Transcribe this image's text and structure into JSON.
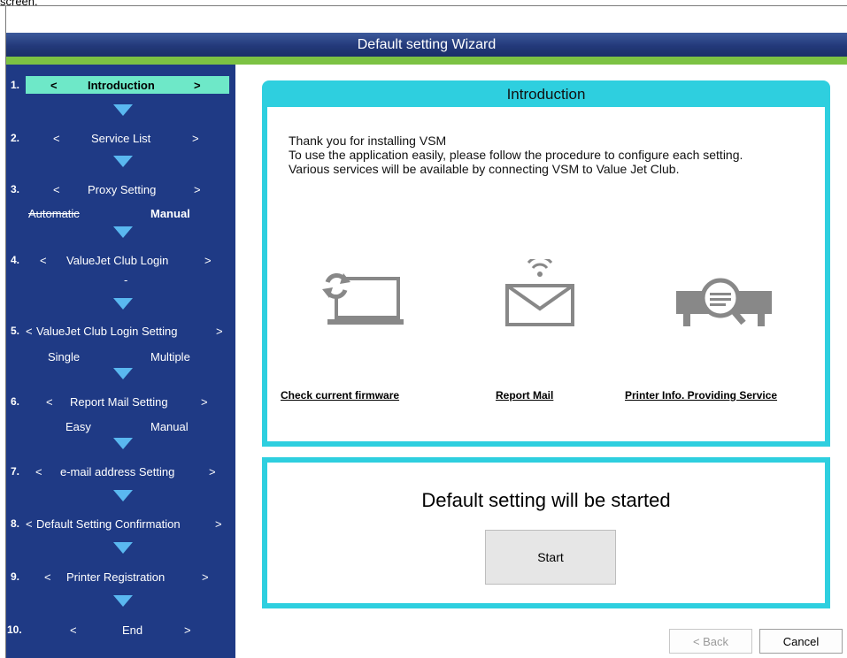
{
  "screen_word": "screen.",
  "window": {
    "title": "Default setting Wizard"
  },
  "steps": [
    {
      "num": "1.",
      "lt": "<",
      "label": "Introduction",
      "gt": ">"
    },
    {
      "num": "2.",
      "lt": "<",
      "label": "Service List",
      "gt": ">"
    },
    {
      "num": "3.",
      "lt": "<",
      "label": "Proxy Setting",
      "gt": ">"
    },
    {
      "num": "4.",
      "lt": "<",
      "label": "ValueJet Club Login",
      "gt": ">"
    },
    {
      "num": "5.",
      "lt": "<",
      "label": "ValueJet Club Login Setting",
      "gt": ">"
    },
    {
      "num": "6.",
      "lt": "<",
      "label": "Report Mail Setting",
      "gt": ">"
    },
    {
      "num": "7.",
      "lt": "<",
      "label": "e-mail address Setting",
      "gt": ">"
    },
    {
      "num": "8.",
      "lt": "<",
      "label": "Default Setting Confirmation",
      "gt": ">"
    },
    {
      "num": "9.",
      "lt": "<",
      "label": "Printer Registration",
      "gt": ">"
    },
    {
      "num": "10.",
      "lt": "<",
      "label": "End",
      "gt": ">"
    }
  ],
  "substeps": {
    "proxy": {
      "automatic": "Automatic",
      "manual": "Manual"
    },
    "login": {
      "dash": "-"
    },
    "login_setting": {
      "single": "Single",
      "multiple": "Multiple"
    },
    "report_mail": {
      "easy": "Easy",
      "manual": "Manual"
    }
  },
  "intro_panel": {
    "title": "Introduction",
    "text_line1": "Thank you for installing VSM",
    "text_line2": "To use the application easily, please follow the procedure to configure each setting.",
    "text_line3": "Various services will be available by connecting VSM to Value Jet Club.",
    "services": [
      {
        "icon": "laptop-refresh-icon",
        "label": "Check current firmware"
      },
      {
        "icon": "mail-wireless-icon",
        "label": "Report Mail"
      },
      {
        "icon": "printer-search-icon",
        "label": "Printer Info. Providing Service"
      }
    ]
  },
  "start_panel": {
    "message": "Default setting will be started",
    "start_label": "Start"
  },
  "footer": {
    "back_label": "< Back",
    "cancel_label": "Cancel"
  },
  "colors": {
    "sidebar": "#1f3a85",
    "accent": "#2ecfdf",
    "green": "#7cc243",
    "active_step": "#6ee8c8",
    "arrow": "#5ab8f0"
  }
}
